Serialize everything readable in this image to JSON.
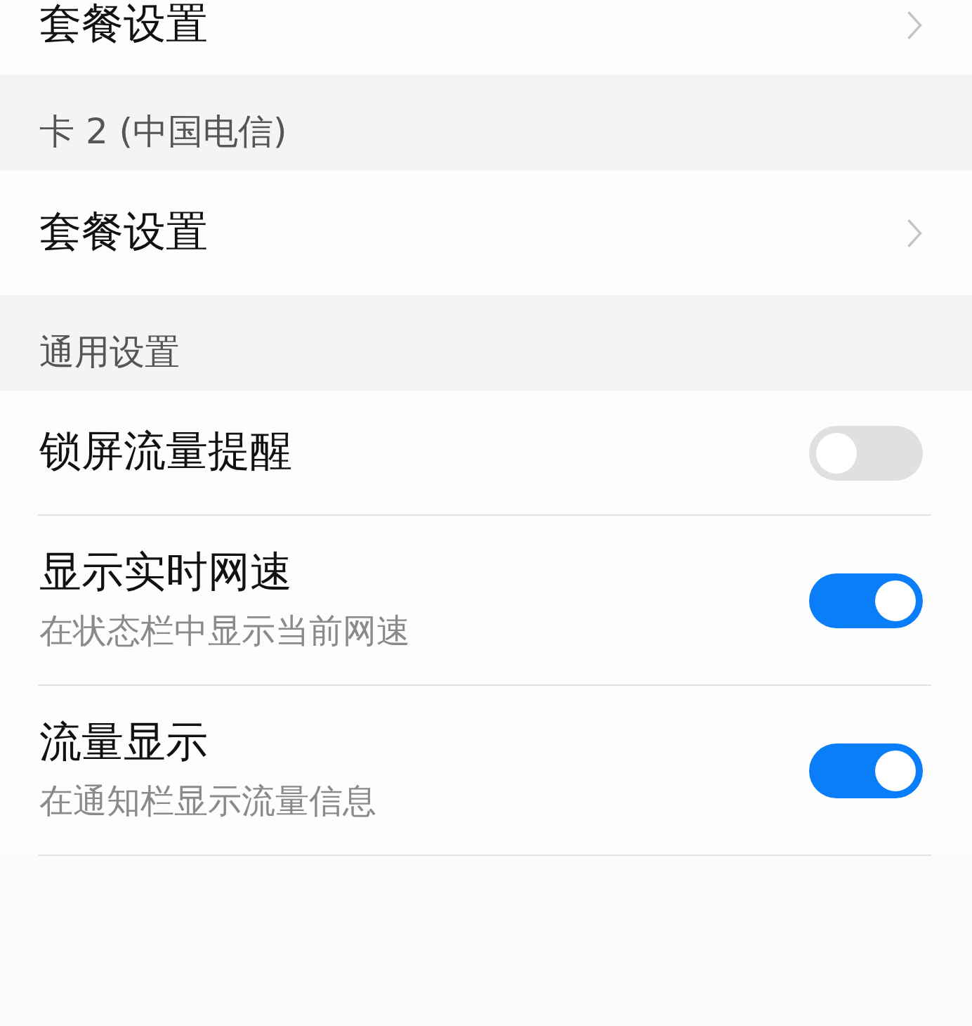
{
  "sections": [
    {
      "items": [
        {
          "kind": "nav",
          "title": "套餐设置"
        }
      ]
    },
    {
      "header": "卡 2 (中国电信)",
      "items": [
        {
          "kind": "nav",
          "title": "套餐设置"
        }
      ]
    },
    {
      "header": "通用设置",
      "items": [
        {
          "kind": "toggle",
          "title": "锁屏流量提醒",
          "on": false
        },
        {
          "kind": "toggle",
          "title": "显示实时网速",
          "subtitle": "在状态栏中显示当前网速",
          "on": true
        },
        {
          "kind": "toggle",
          "title": "流量显示",
          "subtitle": "在通知栏显示流量信息",
          "on": true
        }
      ]
    }
  ]
}
